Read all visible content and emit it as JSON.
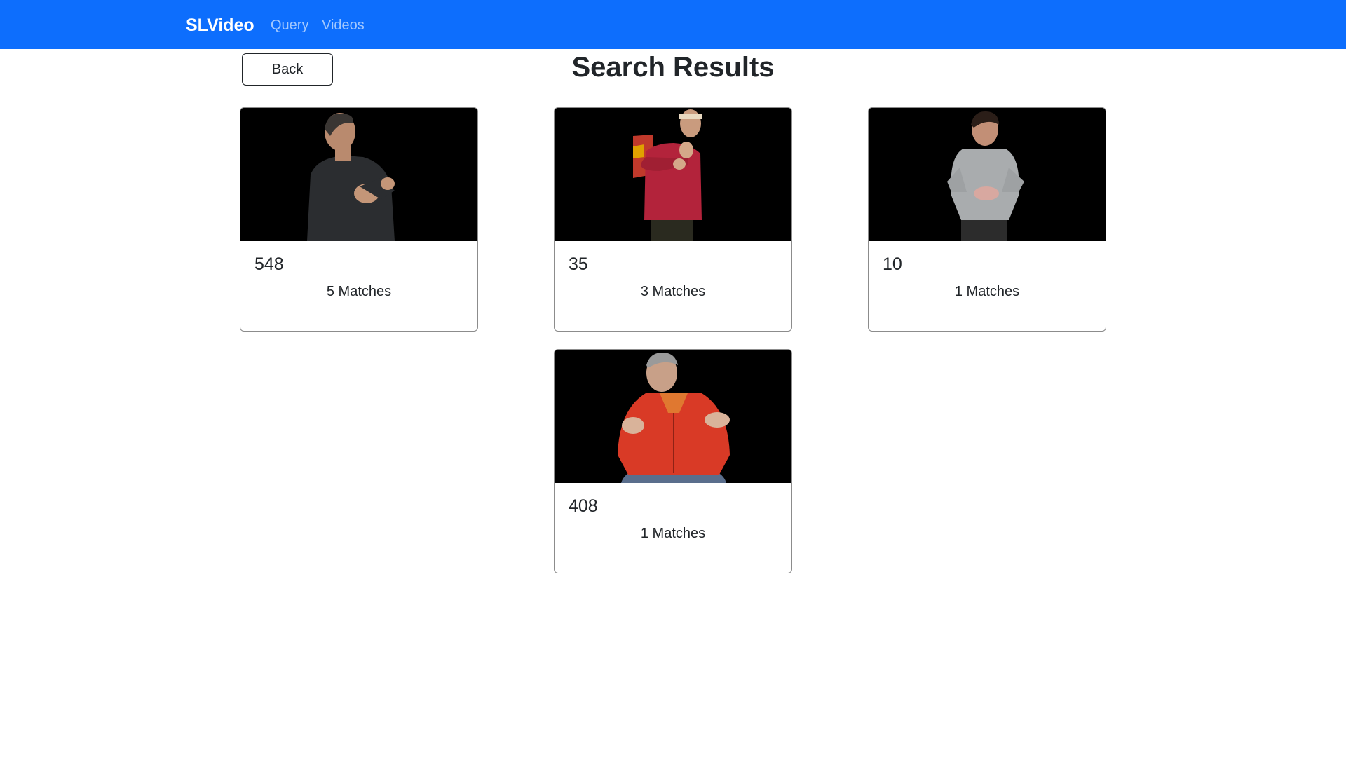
{
  "navbar": {
    "brand": "SLVideo",
    "links": [
      {
        "label": "Query"
      },
      {
        "label": "Videos"
      }
    ],
    "color": "#0d6efd"
  },
  "page": {
    "back_label": "Back",
    "title": "Search Results"
  },
  "results": [
    {
      "id": "548",
      "matches": "5 Matches",
      "thumbnail": "man-dark-polo-signing"
    },
    {
      "id": "35",
      "matches": "3 Matches",
      "thumbnail": "woman-red-hoodie-signing"
    },
    {
      "id": "10",
      "matches": "1 Matches",
      "thumbnail": "man-grey-sweater-signing"
    },
    {
      "id": "408",
      "matches": "1 Matches",
      "thumbnail": "man-red-jacket-signing"
    }
  ]
}
